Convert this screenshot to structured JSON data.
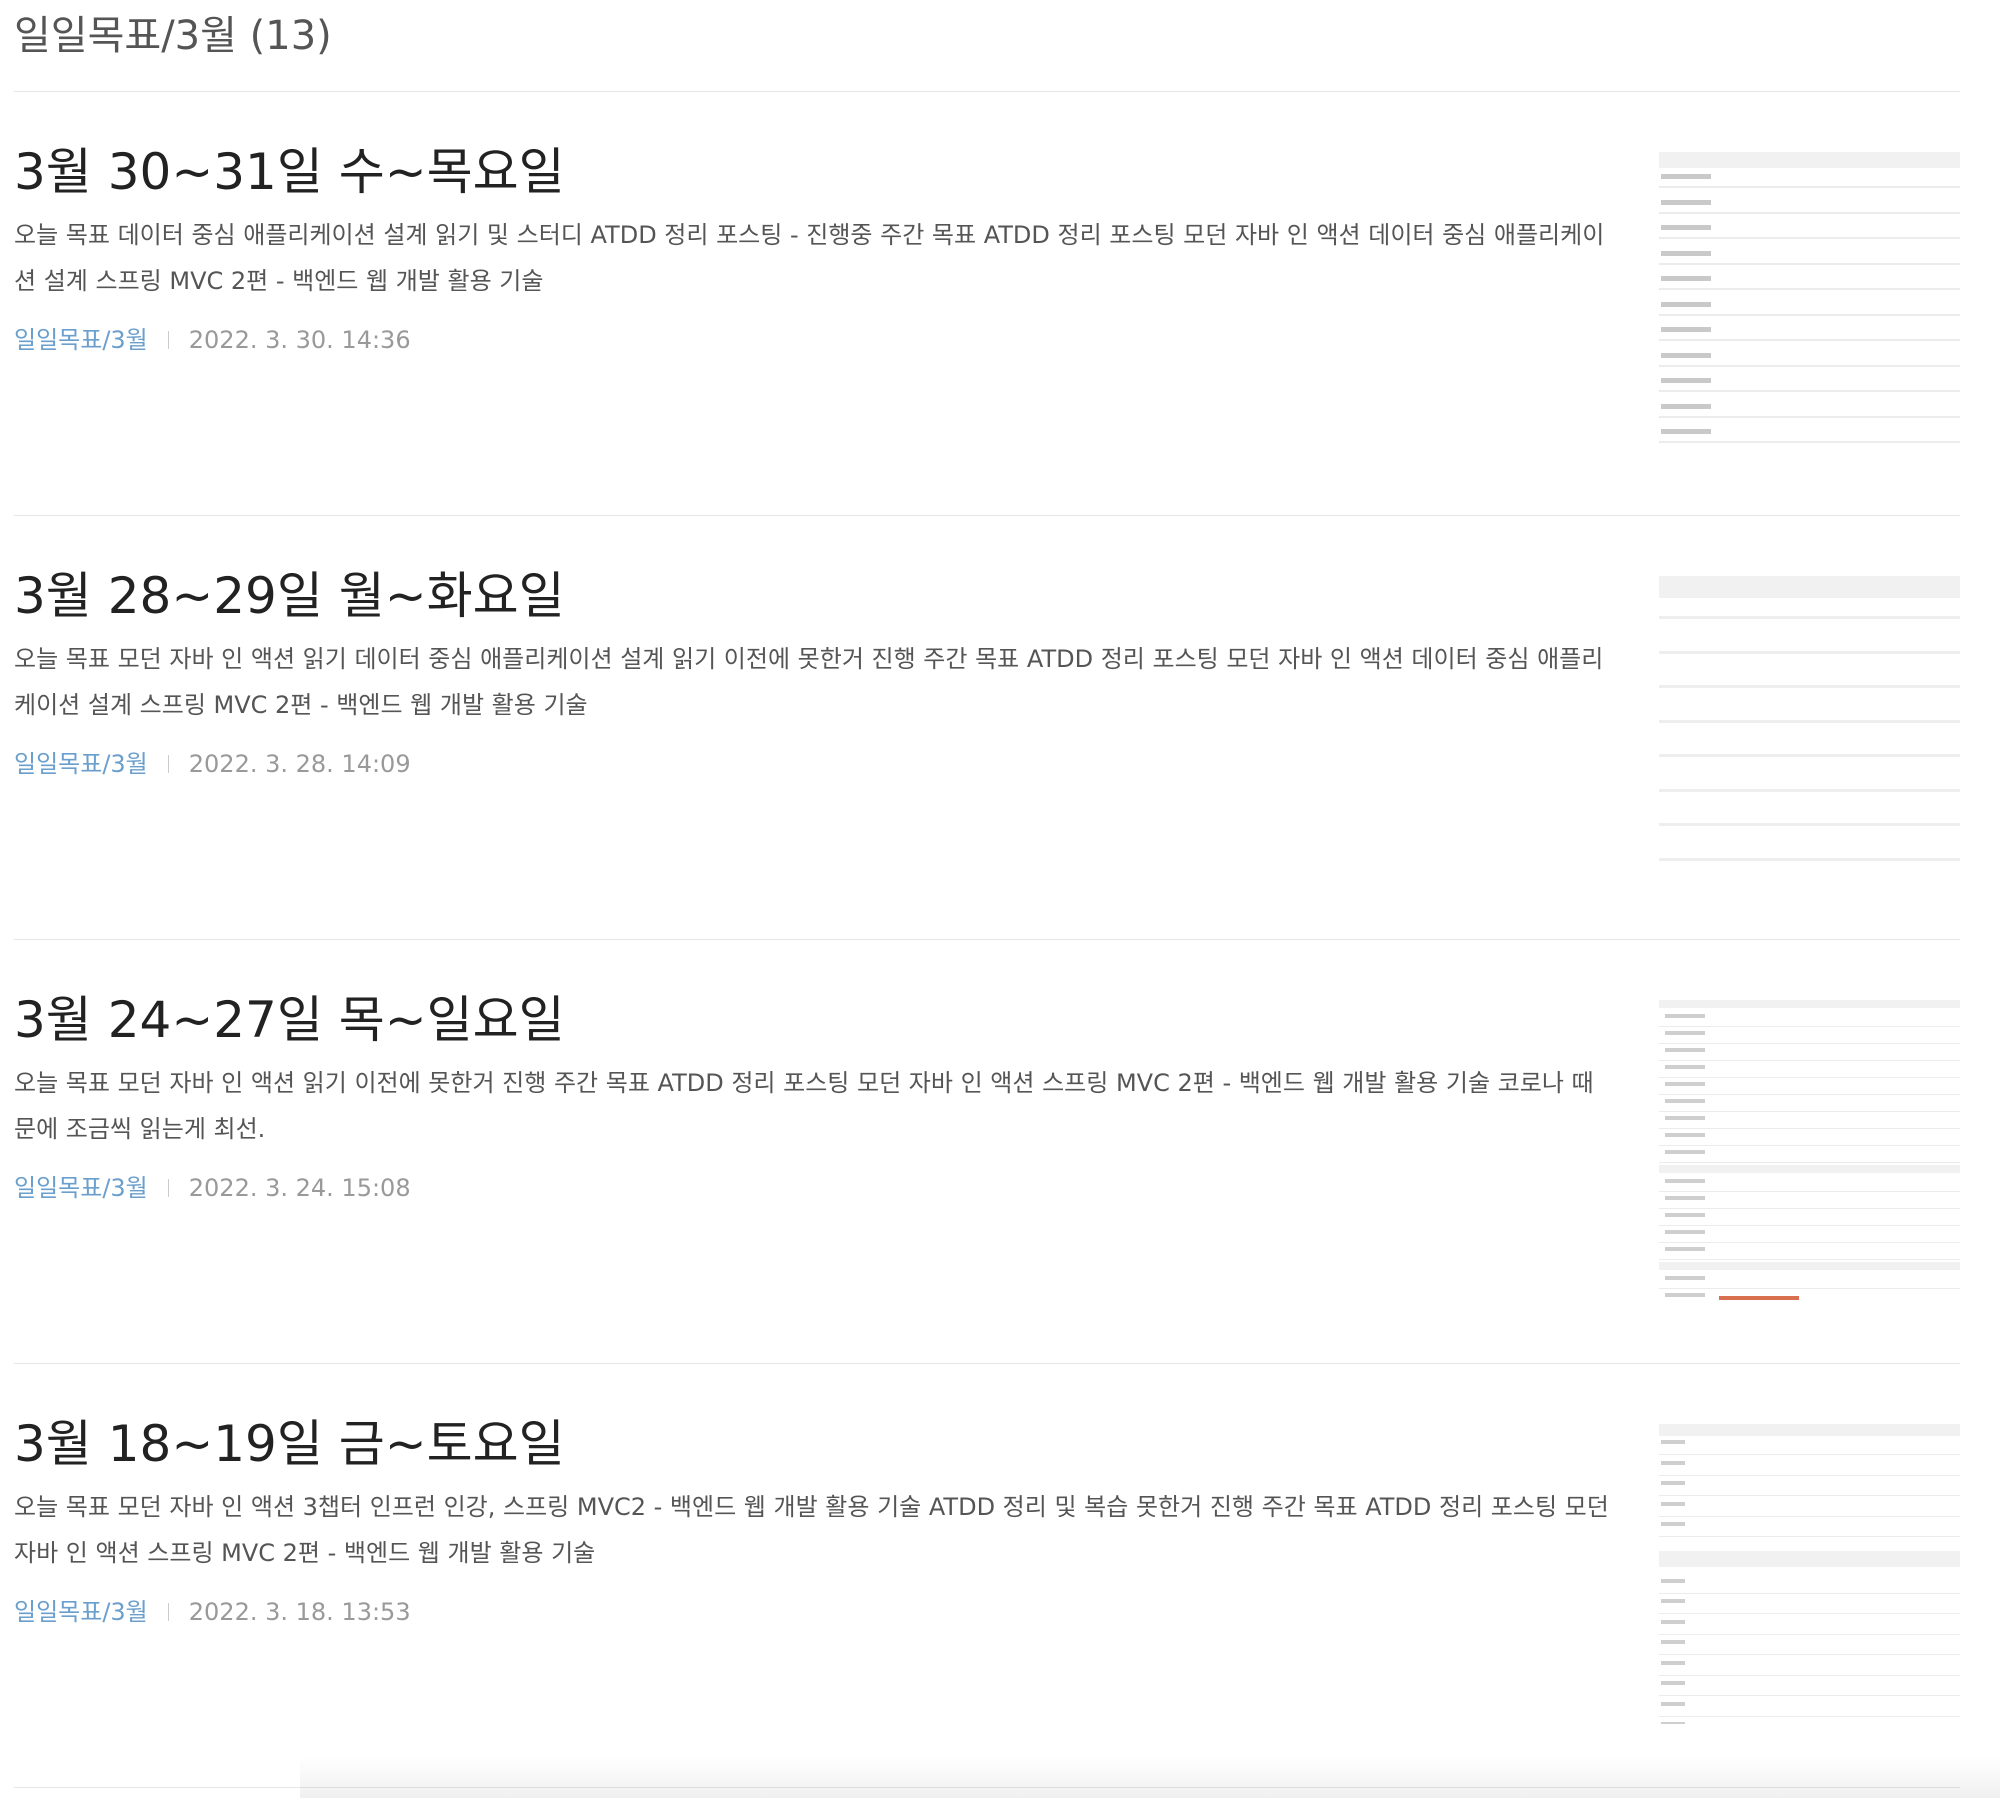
{
  "category": {
    "title": "일일목표/3월 (13)"
  },
  "posts": [
    {
      "title": "3월 30~31일 수~목요일",
      "summary": "오늘 목표 데이터 중심 애플리케이션 설계 읽기 및 스터디 ATDD 정리 포스팅 - 진행중 주간 목표 ATDD 정리 포스팅 모던 자바 인 액션 데이터 중심 애플리케이션 설계 스프링 MVC 2편 - 백엔드 웹 개발 활용 기술",
      "category": "일일목표/3월",
      "date": "2022. 3. 30. 14:36"
    },
    {
      "title": "3월 28~29일 월~화요일",
      "summary": "오늘 목표 모던 자바 인 액션 읽기 데이터 중심 애플리케이션 설계 읽기 이전에 못한거 진행 주간 목표 ATDD 정리 포스팅 모던 자바 인 액션 데이터 중심 애플리케이션 설계 스프링 MVC 2편 - 백엔드 웹 개발 활용 기술",
      "category": "일일목표/3월",
      "date": "2022. 3. 28. 14:09"
    },
    {
      "title": "3월 24~27일 목~일요일",
      "summary": "오늘 목표 모던 자바 인 액션 읽기 이전에 못한거 진행 주간 목표 ATDD 정리 포스팅 모던 자바 인 액션 스프링 MVC 2편 - 백엔드 웹 개발 활용 기술 코로나 때문에 조금씩 읽는게 최선.",
      "category": "일일목표/3월",
      "date": "2022. 3. 24. 15:08"
    },
    {
      "title": "3월 18~19일 금~토요일",
      "summary": "오늘 목표 모던 자바 인 액션 3챕터 인프런 인강, 스프링 MVC2 - 백엔드 웹 개발 활용 기술 ATDD 정리 및 복습 못한거 진행 주간 목표 ATDD 정리 포스팅 모던 자바 인 액션 스프링 MVC 2편 - 백엔드 웹 개발 활용 기술",
      "category": "일일목표/3월",
      "date": "2022. 3. 18. 13:53"
    }
  ],
  "colors": {
    "category_link": "#6a9fcd",
    "date": "#999999",
    "title": "#222222",
    "summary": "#555555",
    "divider": "#e6e6e6"
  }
}
